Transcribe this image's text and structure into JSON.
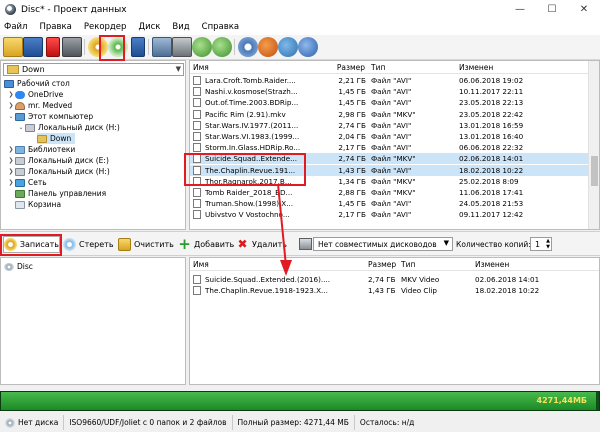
{
  "window": {
    "title": "Disc* - Проект данных"
  },
  "menu": [
    "Файл",
    "Правка",
    "Рекордер",
    "Диск",
    "Вид",
    "Справка"
  ],
  "folder_combo": {
    "value": "Down"
  },
  "tree": [
    {
      "label": "Рабочий стол",
      "icon": "desktop-icon"
    },
    {
      "label": "OneDrive",
      "icon": "cloud-icon"
    },
    {
      "label": "mr. Medved",
      "icon": "user-icon"
    },
    {
      "label": "Этот компьютер",
      "icon": "computer-icon"
    },
    {
      "label": "Локальный диск (H:)",
      "icon": "drive-icon"
    },
    {
      "label": "Down",
      "icon": "folder-icon"
    },
    {
      "label": "Библиотеки",
      "icon": "library-icon"
    },
    {
      "label": "Локальный диск (E:)",
      "icon": "drive-icon"
    },
    {
      "label": "Локальный диск (H:)",
      "icon": "drive-icon"
    },
    {
      "label": "Сеть",
      "icon": "network-icon"
    },
    {
      "label": "Панель управления",
      "icon": "control-panel-icon"
    },
    {
      "label": "Корзина",
      "icon": "recycle-bin-icon"
    }
  ],
  "file_list": {
    "headers": {
      "name": "Имя",
      "size": "Размер",
      "type": "Тип",
      "modified": "Изменен"
    },
    "rows": [
      {
        "name": "Lara.Croft.Tomb.Raider....",
        "size": "2,21 ГБ",
        "type": "Файл \"AVI\"",
        "modified": "06.06.2018 19:02"
      },
      {
        "name": "Nashi.v.kosmose(Strazh...",
        "size": "1,45 ГБ",
        "type": "Файл \"AVI\"",
        "modified": "10.11.2017 22:11"
      },
      {
        "name": "Out.of.Time.2003.BDRip...",
        "size": "1,45 ГБ",
        "type": "Файл \"AVI\"",
        "modified": "23.05.2018 22:13"
      },
      {
        "name": "Pacific Rim (2.91).mkv",
        "size": "2,98 ГБ",
        "type": "Файл \"MKV\"",
        "modified": "23.05.2018 22:42"
      },
      {
        "name": "Star.Wars.IV.1977.(2011...",
        "size": "2,74 ГБ",
        "type": "Файл \"AVI\"",
        "modified": "13.01.2018 16:59"
      },
      {
        "name": "Star.Wars.VI.1983.(1999...",
        "size": "2,04 ГБ",
        "type": "Файл \"AVI\"",
        "modified": "13.01.2018 16:40"
      },
      {
        "name": "Storm.In.Glass.HDRip.Ro...",
        "size": "2,17 ГБ",
        "type": "Файл \"AVI\"",
        "modified": "06.06.2018 22:32"
      },
      {
        "name": "Suicide.Squad..Extende...",
        "size": "2,74 ГБ",
        "type": "Файл \"MKV\"",
        "modified": "02.06.2018 14:01"
      },
      {
        "name": "The.Chaplin.Revue.191...",
        "size": "1,43 ГБ",
        "type": "Файл \"AVI\"",
        "modified": "18.02.2018 10:22"
      },
      {
        "name": "Thor.Ragnarok.2017.B...",
        "size": "1,34 ГБ",
        "type": "Файл \"MKV\"",
        "modified": "25.02.2018 8:09"
      },
      {
        "name": "Tomb Raider_2018_BD...",
        "size": "2,88 ГБ",
        "type": "Файл \"MKV\"",
        "modified": "11.06.2018 17:41"
      },
      {
        "name": "Truman.Show.(1998).X...",
        "size": "1,45 ГБ",
        "type": "Файл \"AVI\"",
        "modified": "24.05.2018 21:53"
      },
      {
        "name": "Ubivstvo V Vostochno...",
        "size": "2,17 ГБ",
        "type": "Файл \"AVI\"",
        "modified": "09.11.2017 12:42"
      }
    ]
  },
  "actions": {
    "burn": "Записать",
    "erase": "Стереть",
    "clear": "Очистить",
    "add": "Добавить",
    "delete": "Удалить",
    "drive": "Нет совместимых дисководов",
    "copies_label": "Количество копий:",
    "copies": "1"
  },
  "disc_tree": {
    "root": "Disc"
  },
  "disc_list": {
    "headers": {
      "name": "Имя",
      "size": "Размер",
      "type": "Тип",
      "modified": "Изменен"
    },
    "rows": [
      {
        "name": "Suicide.Squad..Extended.(2016)....",
        "size": "2,74 ГБ",
        "type": "MKV Video",
        "modified": "02.06.2018 14:01"
      },
      {
        "name": "The.Chaplin.Revue.1918-1923.X...",
        "size": "1,43 ГБ",
        "type": "Video Clip",
        "modified": "18.02.2018 10:22"
      }
    ]
  },
  "progress": {
    "text": "4271,44МБ",
    "fraction": 0.995
  },
  "status": {
    "disc": "Нет диска",
    "format": "ISO9660/UDF/Joliet с 0 папок и 2 файлов",
    "total": "Полный размер: 4271,44 МБ",
    "remaining": "Осталось: н/д"
  },
  "colors": {
    "highlight": "#e01b22",
    "progress_fill": "#1d8a25",
    "selection": "#cce4f7"
  }
}
